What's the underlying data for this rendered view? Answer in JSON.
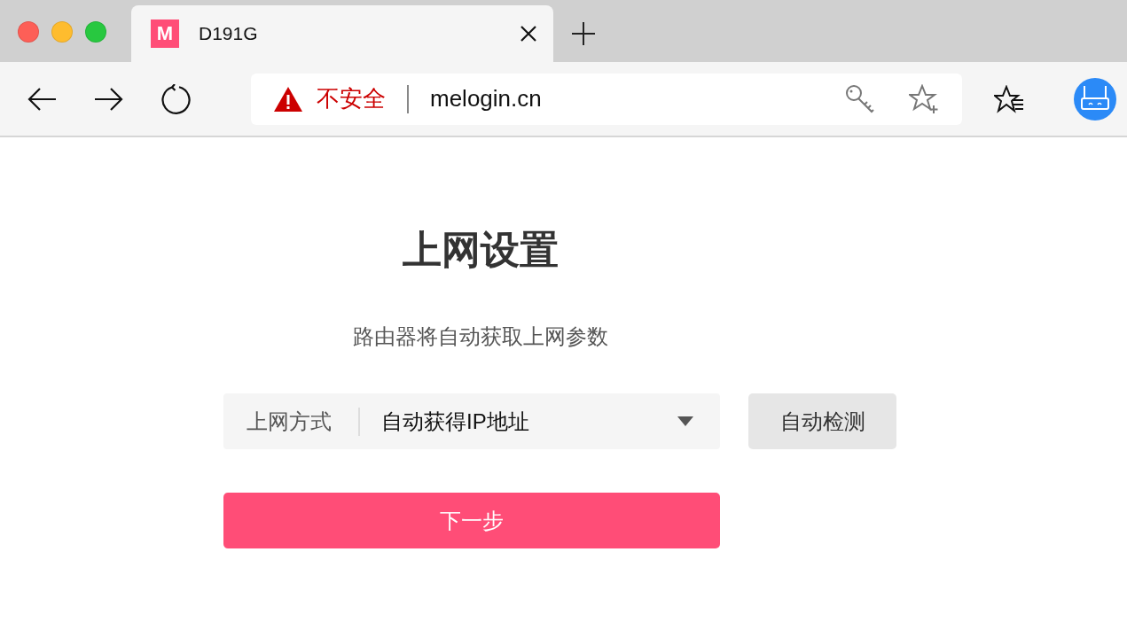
{
  "tabs": [
    {
      "favicon": "M",
      "title": "D191G",
      "selected": true
    }
  ],
  "toolbar": {
    "security": "不安全",
    "url": "melogin.cn"
  },
  "page": {
    "title": "上网设置",
    "subtitle": "路由器将自动获取上网参数",
    "connection": {
      "label": "上网方式",
      "value": "自动获得IP地址"
    },
    "detect_button": "自动检测",
    "next_button": "下一步"
  }
}
